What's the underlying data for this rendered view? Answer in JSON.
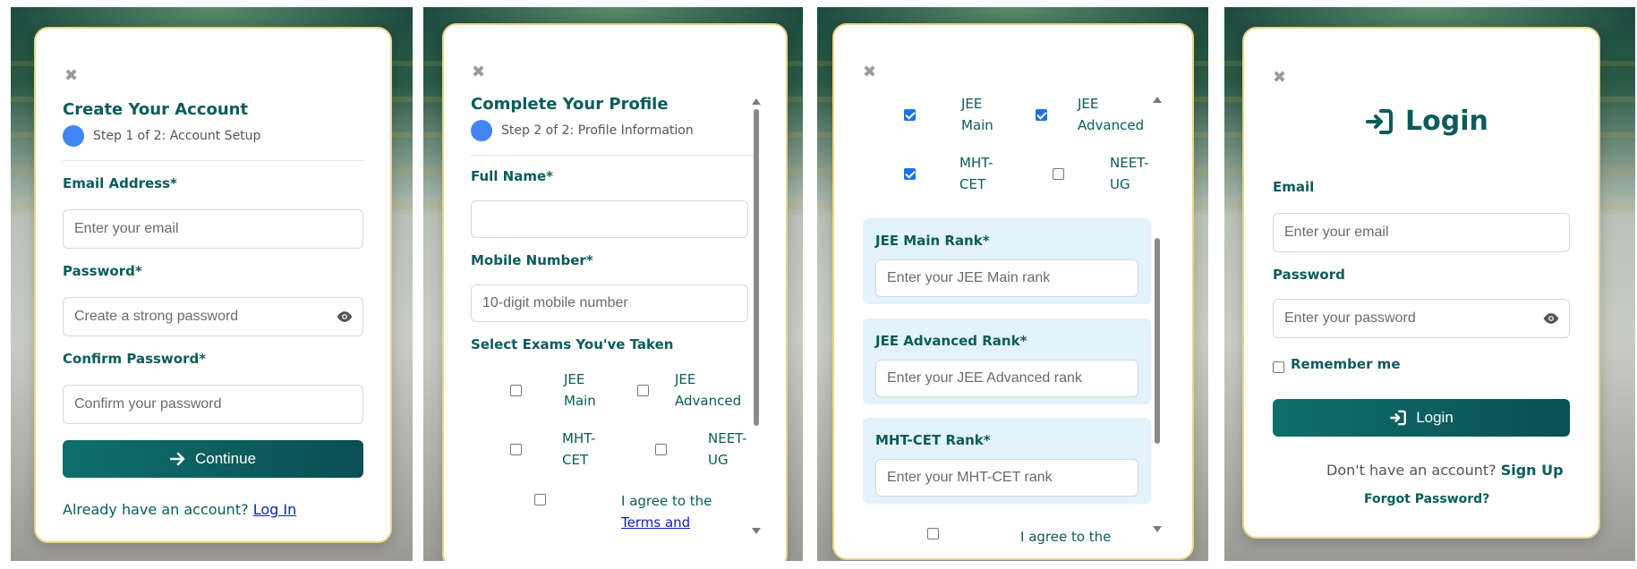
{
  "screen1": {
    "close_icon": "✖",
    "title": "Create Your Account",
    "step": "Step 1 of 2: Account Setup",
    "email_label": "Email Address*",
    "email_placeholder": "Enter your email",
    "password_label": "Password*",
    "password_placeholder": "Create a strong password",
    "confirm_label": "Confirm Password*",
    "confirm_placeholder": "Confirm your password",
    "continue_label": "Continue",
    "footer_text": "Already have an account?",
    "footer_link": "Log In"
  },
  "screen2": {
    "close_icon": "✖",
    "title": "Complete Your Profile",
    "step": "Step 2 of 2: Profile Information",
    "fullname_label": "Full Name*",
    "fullname_value": "",
    "mobile_label": "Mobile Number*",
    "mobile_placeholder": "10-digit mobile number",
    "exams_label": "Select Exams You've Taken",
    "exams": [
      {
        "line1": "JEE",
        "line2": "Main",
        "checked": false
      },
      {
        "line1": "JEE",
        "line2": "Advanced",
        "checked": false
      },
      {
        "line1": "MHT-",
        "line2": "CET",
        "checked": false
      },
      {
        "line1": "NEET-",
        "line2": "UG",
        "checked": false
      }
    ],
    "agree_text": "I agree to the",
    "agree_link": "Terms and"
  },
  "screen3": {
    "close_icon": "✖",
    "exams": [
      {
        "line1": "JEE",
        "line2": "Main",
        "checked": true
      },
      {
        "line1": "JEE",
        "line2": "Advanced",
        "checked": true
      },
      {
        "line1": "MHT-",
        "line2": "CET",
        "checked": true
      },
      {
        "line1": "NEET-",
        "line2": "UG",
        "checked": false
      }
    ],
    "jee_main_label": "JEE Main Rank*",
    "jee_main_placeholder": "Enter your JEE Main rank",
    "jee_adv_label": "JEE Advanced Rank*",
    "jee_adv_placeholder": "Enter your JEE Advanced rank",
    "mht_label": "MHT-CET Rank*",
    "mht_placeholder": "Enter your MHT-CET rank",
    "agree_text": "I agree to the"
  },
  "screen4": {
    "close_icon": "✖",
    "title": "Login",
    "email_label": "Email",
    "email_placeholder": "Enter your email",
    "password_label": "Password",
    "password_placeholder": "Enter your password",
    "remember_label": "Remember me",
    "login_button": "Login",
    "signup_text": "Don't have an account?",
    "signup_link": "Sign Up",
    "forgot_link": "Forgot Password?"
  },
  "colors": {
    "brand": "#0a5c5a",
    "step_dot": "#4285f4",
    "link_blue": "#0b1fb0",
    "card_border": "#e8d58a",
    "rank_box": "#e3f2fb"
  }
}
